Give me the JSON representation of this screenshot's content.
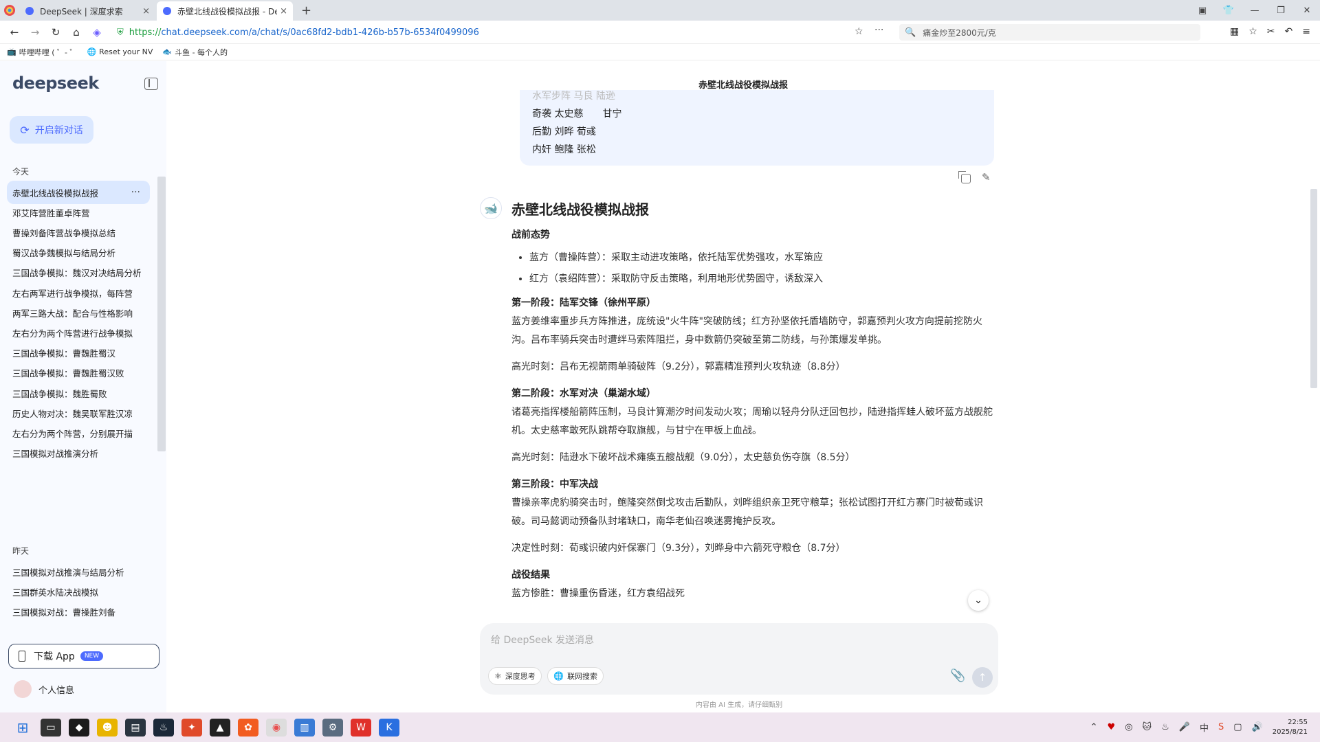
{
  "browser": {
    "tabs": [
      {
        "title": "DeepSeek | 深度求索",
        "close": "×"
      },
      {
        "title": "赤壁北线战役模拟战报 - Dee",
        "close": "×"
      }
    ],
    "new_tab": "+",
    "url_prefix": "https://",
    "url_host": "chat.deepseek.com",
    "url_path": "/a/chat/s/0ac68fd2-bdb1-426b-b57b-6534f0499096",
    "search_text": "痛金炒至2800元/克",
    "bookmarks": [
      "哔哩哔哩 ( ゜- ゜",
      "Reset your NV",
      "斗鱼 - 每个人的"
    ]
  },
  "sidebar": {
    "logo": "deepseek",
    "new_chat": "开启新对话",
    "today_label": "今天",
    "today": [
      "赤壁北线战役模拟战报",
      "邓艾阵营胜董卓阵营",
      "曹操刘备阵营战争模拟总结",
      "蜀汉战争魏模拟与结局分析",
      "三国战争模拟：魏汉对决结局分析",
      "左右两军进行战争模拟，每阵营",
      "两军三路大战：配合与性格影响",
      "左右分为两个阵营进行战争模拟",
      "三国战争模拟：曹魏胜蜀汉",
      "三国战争模拟：曹魏胜蜀汉败",
      "三国战争模拟：魏胜蜀败",
      "历史人物对决：魏吴联军胜汉凉",
      "左右分为两个阵营，分别展开描",
      "三国模拟对战推演分析"
    ],
    "yesterday_label": "昨天",
    "yesterday": [
      "三国模拟对战推演与结局分析",
      "三国群英水陆决战模拟",
      "三国模拟对战：曹操胜刘备"
    ],
    "download": "下载 App",
    "new_badge": "NEW",
    "profile": "个人信息"
  },
  "chat": {
    "title": "赤壁北线战役模拟战报",
    "user_msg": {
      "faded": "水军步阵  马良  陆逊",
      "lines": [
        "奇袭 太史慈　　甘宁",
        "后勤 刘晔 荀彧",
        "内奸 鲍隆 张松"
      ]
    },
    "response": {
      "heading": "赤壁北线战役模拟战报",
      "pre_title": "战前态势",
      "pre_items": [
        "蓝方（曹操阵营）：采取主动进攻策略，依托陆军优势强攻，水军策应",
        "红方（袁绍阵营）：采取防守反击策略，利用地形优势固守，诱敌深入"
      ],
      "stage1_title": "第一阶段：陆军交锋（徐州平原）",
      "stage1_text": "蓝方姜维率重步兵方阵推进，庞统设\"火牛阵\"突破防线；红方孙坚依托盾墙防守，郭嘉预判火攻方向提前挖防火沟。吕布率骑兵突击时遭绊马索阵阻拦，身中数箭仍突破至第二防线，与孙策爆发单挑。",
      "stage1_high": "高光时刻：吕布无视箭雨单骑破阵（9.2分），郭嘉精准预判火攻轨迹（8.8分）",
      "stage2_title": "第二阶段：水军对决（巢湖水域）",
      "stage2_text": "诸葛亮指挥楼船箭阵压制，马良计算潮汐时间发动火攻；周瑜以轻舟分队迂回包抄，陆逊指挥蛙人破坏蓝方战舰舵机。太史慈率敢死队跳帮夺取旗舰，与甘宁在甲板上血战。",
      "stage2_high": "高光时刻：陆逊水下破坏战术瘫痪五艘战舰（9.0分），太史慈负伤夺旗（8.5分）",
      "stage3_title": "第三阶段：中军决战",
      "stage3_text": "曹操亲率虎豹骑突击时，鲍隆突然倒戈攻击后勤队，刘晔组织亲卫死守粮草；张松试图打开红方寨门时被荀彧识破。司马懿调动预备队封堵缺口，南华老仙召唤迷雾掩护反攻。",
      "stage3_high": "决定性时刻：荀彧识破内奸保寨门（9.3分），刘晔身中六箭死守粮仓（8.7分）",
      "result_title": "战役结果",
      "result_text": "蓝方惨胜：曹操重伤昏迷，红方袁绍战死"
    },
    "input_placeholder": "给 DeepSeek 发送消息",
    "deep_think": "深度思考",
    "web_search": "联网搜索",
    "disclaimer": "内容由 AI 生成，请仔细甄别"
  },
  "taskbar": {
    "time": "22:55",
    "date": "2025/8/21",
    "ime": "中"
  },
  "colors": {
    "accent": "#4d6bfe",
    "sidebar_bg": "#f8faff",
    "selected_bg": "#dbe8ff",
    "user_bubble": "#eff4ff",
    "url_green": "#1a9d3c"
  }
}
